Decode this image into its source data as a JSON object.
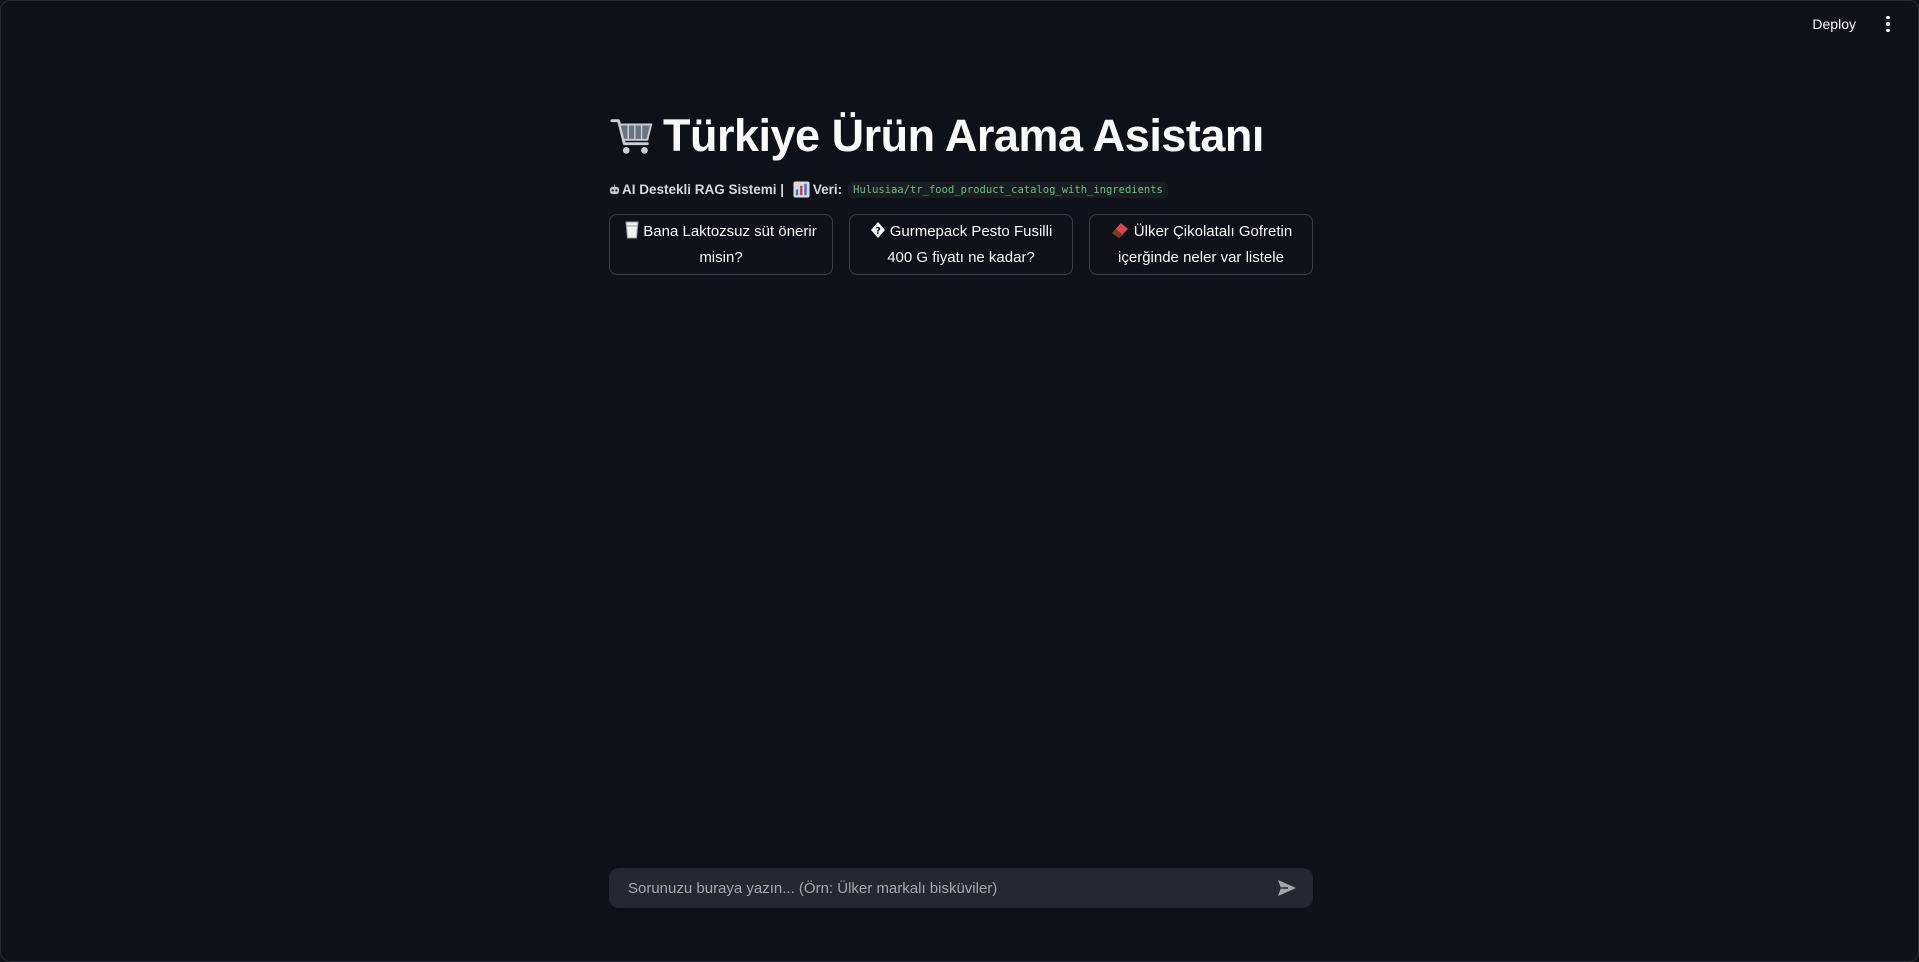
{
  "header": {
    "deploy_label": "Deploy",
    "menu_icon": "vertical-ellipsis-icon"
  },
  "main": {
    "title_icon": "shopping-cart-icon",
    "title": "Türkiye Ürün Arama Asistanı",
    "subtitle_icon": "robot-icon",
    "subtitle_text": "AI Destekli RAG Sistemi | ",
    "data_icon": "bar-chart-icon",
    "data_label": "Veri:",
    "dataset": "Hulusiaa/tr_food_product_catalog_with_ingredients"
  },
  "examples": [
    {
      "icon": "milk-glass-icon",
      "label": "Bana Laktozsuz süt önerir misin?"
    },
    {
      "icon": "unknown-glyph-icon",
      "label": "Gurmepack Pesto Fusilli 400 G fiyatı ne kadar?"
    },
    {
      "icon": "chocolate-bar-icon",
      "label": "Ülker Çikolatalı Gofretin içerğinde neler var listele"
    }
  ],
  "chat": {
    "placeholder": "Sorunuzu buraya yazın... (Örn: Ülker markalı bisküviler)",
    "value": "",
    "send_icon": "send-icon"
  }
}
